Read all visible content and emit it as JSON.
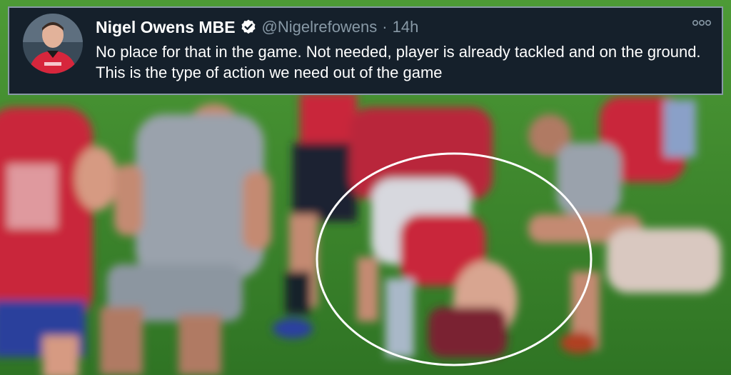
{
  "tweet": {
    "display_name": "Nigel Owens MBE",
    "handle": "@Nigelrefowens",
    "separator": "·",
    "time": "14h",
    "text": "No place for that in the game. Not needed, player is already tackled and on the ground. This is the type of action we need out of the game",
    "avatar_icon": "referee-avatar",
    "verified_icon": "verified-badge-icon",
    "more_icon": "more-options-icon"
  },
  "colors": {
    "card_bg": "#15202b",
    "text_primary": "#ffffff",
    "text_secondary": "#8899a6",
    "pitch_green": "#3f8a2e",
    "jersey_red": "#c9283a",
    "jersey_grey": "#9aa2ac",
    "highlight_circle": "#ffffff"
  }
}
